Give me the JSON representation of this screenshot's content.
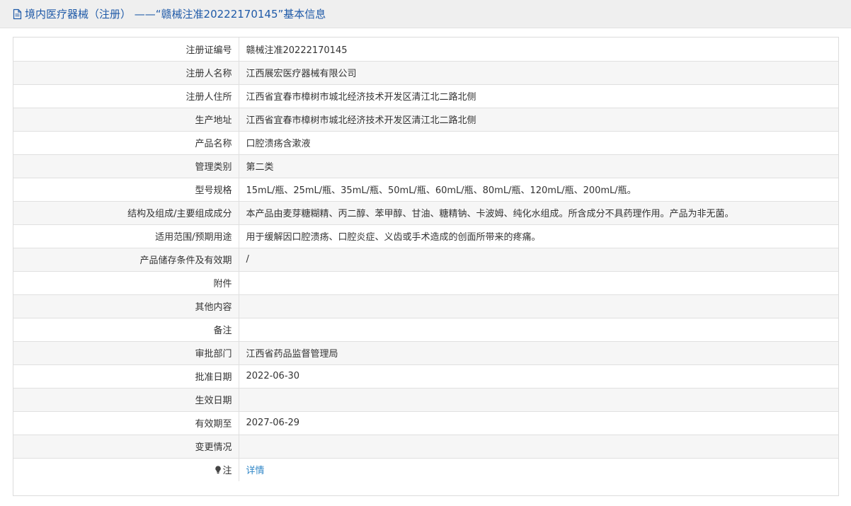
{
  "header": {
    "title": "境内医疗器械（注册） ——“赣械注准20222170145”基本信息",
    "icon": "document-icon"
  },
  "rows": [
    {
      "label": "注册证编号",
      "value": "赣械注准20222170145"
    },
    {
      "label": "注册人名称",
      "value": "江西展宏医疗器械有限公司"
    },
    {
      "label": "注册人住所",
      "value": "江西省宜春市樟树市城北经济技术开发区清江北二路北侧"
    },
    {
      "label": "生产地址",
      "value": "江西省宜春市樟树市城北经济技术开发区清江北二路北侧"
    },
    {
      "label": "产品名称",
      "value": "口腔溃疡含漱液"
    },
    {
      "label": "管理类别",
      "value": "第二类"
    },
    {
      "label": "型号规格",
      "value": "15mL/瓶、25mL/瓶、35mL/瓶、50mL/瓶、60mL/瓶、80mL/瓶、120mL/瓶、200mL/瓶。"
    },
    {
      "label": "结构及组成/主要组成成分",
      "value": "本产品由麦芽糖糊精、丙二醇、苯甲醇、甘油、糖精钠、卡波姆、纯化水组成。所含成分不具药理作用。产品为非无菌。"
    },
    {
      "label": "适用范围/预期用途",
      "value": "用于缓解因口腔溃疡、口腔炎症、义齿或手术造成的创面所带来的疼痛。"
    },
    {
      "label": "产品储存条件及有效期",
      "value": "/"
    },
    {
      "label": "附件",
      "value": ""
    },
    {
      "label": "其他内容",
      "value": ""
    },
    {
      "label": "备注",
      "value": ""
    },
    {
      "label": "审批部门",
      "value": "江西省药品监督管理局"
    },
    {
      "label": "批准日期",
      "value": "2022-06-30"
    },
    {
      "label": "生效日期",
      "value": ""
    },
    {
      "label": "有效期至",
      "value": "2027-06-29"
    },
    {
      "label": "变更情况",
      "value": ""
    }
  ],
  "note": {
    "icon": "lightbulb-icon",
    "label": "注",
    "link_text": "详情"
  }
}
